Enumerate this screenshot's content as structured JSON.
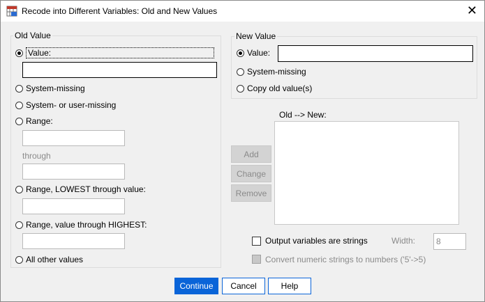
{
  "window": {
    "title": "Recode into Different Variables: Old and New Values",
    "close_glyph": "✕"
  },
  "old_value": {
    "legend": "Old Value",
    "value_label": "Value:",
    "value_input": "",
    "system_missing": "System-missing",
    "sys_or_user_missing": "System- or user-missing",
    "range_label": "Range:",
    "through_label": "through",
    "range_lowest": "Range, LOWEST through value:",
    "range_highest": "Range, value through HIGHEST:",
    "all_other": "All other values"
  },
  "new_value": {
    "legend": "New Value",
    "value_label": "Value:",
    "value_input": "",
    "system_missing": "System-missing",
    "copy_old": "Copy old value(s)"
  },
  "mapping": {
    "label": "Old --> New:",
    "items": []
  },
  "actions": {
    "add": "Add",
    "change": "Change",
    "remove": "Remove"
  },
  "options": {
    "output_strings": "Output variables are strings",
    "width_label": "Width:",
    "width_value": "8",
    "convert_numeric": "Convert numeric strings to numbers ('5'->5)"
  },
  "buttons": {
    "continue": "Continue",
    "cancel": "Cancel",
    "help": "Help"
  },
  "colors": {
    "accent": "#0a64d8",
    "disabled_bg": "#d3d3d3",
    "disabled_text": "#8a8a8a"
  },
  "icons": [
    "app-recode-icon",
    "close-icon"
  ]
}
